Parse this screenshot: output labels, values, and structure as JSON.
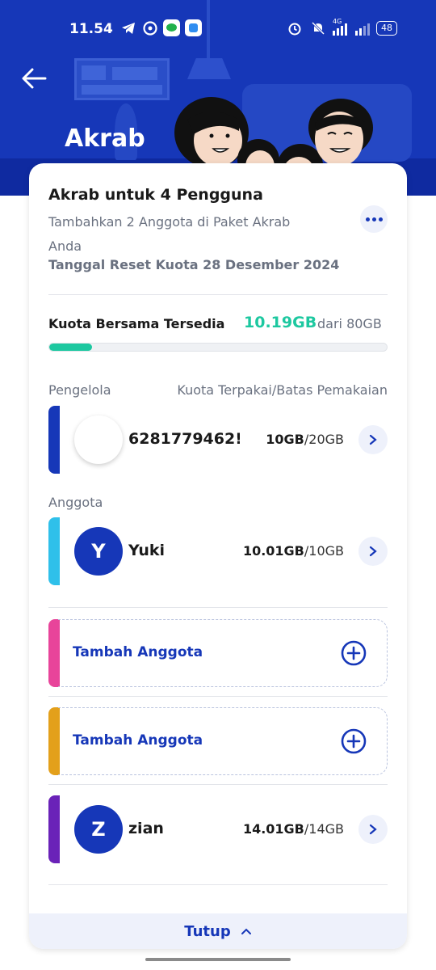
{
  "status_bar": {
    "time": "11.54",
    "network": "4G",
    "battery": "48"
  },
  "header": {
    "title": "Akrab"
  },
  "package": {
    "title": "Akrab untuk 4 Pengguna",
    "description": "Tambahkan 2 Anggota di Paket Akrab Anda",
    "reset": "Tanggal Reset Kuota 28 Desember 2024"
  },
  "quota": {
    "label": "Kuota Bersama Tersedia",
    "available": "10.19GB",
    "total": "dari 80GB",
    "used_fraction": 0.127
  },
  "sections": {
    "manager": "Pengelola",
    "usage_header": "Kuota Terpakai/Batas Pemakaian",
    "members": "Anggota"
  },
  "manager": {
    "name": "6281779462!",
    "used": "10GB",
    "limit": "/20GB",
    "color": "#1637b8"
  },
  "members": [
    {
      "initial": "Y",
      "name": "Yuki",
      "used": "10.01GB",
      "limit": "/10GB",
      "color": "#2fc0ea"
    },
    {
      "initial": "Z",
      "name": "zian",
      "used": "14.01GB",
      "limit": "/14GB",
      "color": "#6a22b8"
    }
  ],
  "add_slots": [
    {
      "label": "Tambah Anggota",
      "color": "#e8449a"
    },
    {
      "label": "Tambah Anggota",
      "color": "#e3a01b"
    }
  ],
  "footer": {
    "close_label": "Tutup"
  },
  "colors": {
    "primary": "#1637b8",
    "accent_green": "#1dc8a0"
  }
}
